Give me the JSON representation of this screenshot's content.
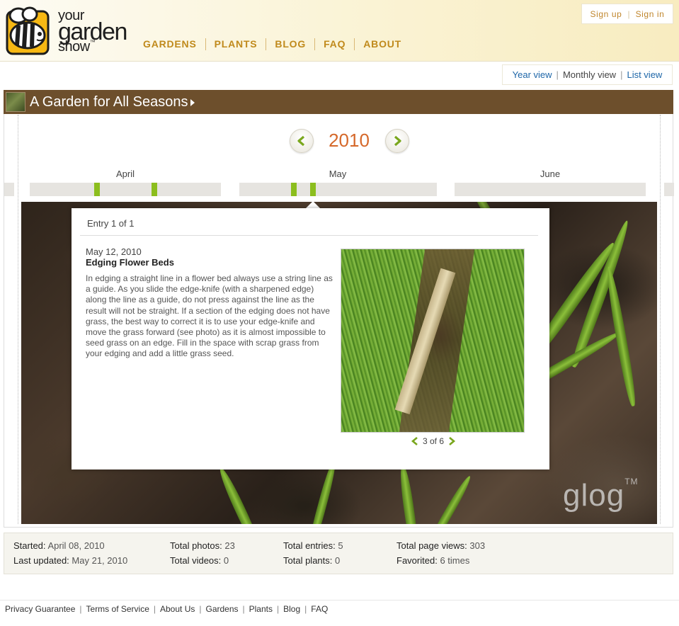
{
  "header": {
    "logo": {
      "line1": "your",
      "line2": "garden",
      "line3": "show",
      "tm": "™"
    },
    "nav": [
      "GARDENS",
      "PLANTS",
      "BLOG",
      "FAQ",
      "ABOUT"
    ],
    "auth": {
      "signup": "Sign up",
      "signin": "Sign in"
    }
  },
  "views": {
    "year": "Year view",
    "monthly": "Monthly view",
    "list": "List view",
    "current": "monthly"
  },
  "garden": {
    "title": "A Garden for All Seasons"
  },
  "year_nav": {
    "year": "2010",
    "prev_icon": "chevron-left-icon",
    "next_icon": "chevron-right-icon"
  },
  "timeline": {
    "months": [
      "April",
      "May",
      "June"
    ]
  },
  "entry": {
    "count": "Entry 1 of 1",
    "date": "May 12, 2010",
    "title": "Edging Flower Beds",
    "body": "In edging a straight line in a flower bed always use a string line as a guide. As you slide the edge-knife (with a sharpened edge) along the line as a guide, do not press against the line as the result will not be straight. If a section of the edging does not have grass, the best way to correct it is to use your edge-knife and move the grass forward (see photo) as it is almost impossible to seed grass on an edge. Fill in the space with scrap grass from your edging and add a little grass seed.",
    "photo_pager": "3 of 6"
  },
  "watermark": {
    "text": "glog",
    "tm": "TM"
  },
  "stats": {
    "started_label": "Started:",
    "started_value": "April 08, 2010",
    "updated_label": "Last updated:",
    "updated_value": "May 21, 2010",
    "photos_label": "Total photos:",
    "photos_value": "23",
    "videos_label": "Total videos:",
    "videos_value": "0",
    "entries_label": "Total entries:",
    "entries_value": "5",
    "plants_label": "Total plants:",
    "plants_value": "0",
    "views_label": "Total page views:",
    "views_value": "303",
    "favorited_label": "Favorited:",
    "favorited_value": "6 times"
  },
  "footer": {
    "links": [
      "Privacy Guarantee",
      "Terms of Service",
      "About Us",
      "Gardens",
      "Plants",
      "Blog",
      "FAQ"
    ]
  },
  "colors": {
    "accent": "#c08a1c",
    "titlebar": "#6d4f2c",
    "year": "#d5682a",
    "timeline_mark": "#8cbe1e",
    "link": "#1d66a8"
  }
}
